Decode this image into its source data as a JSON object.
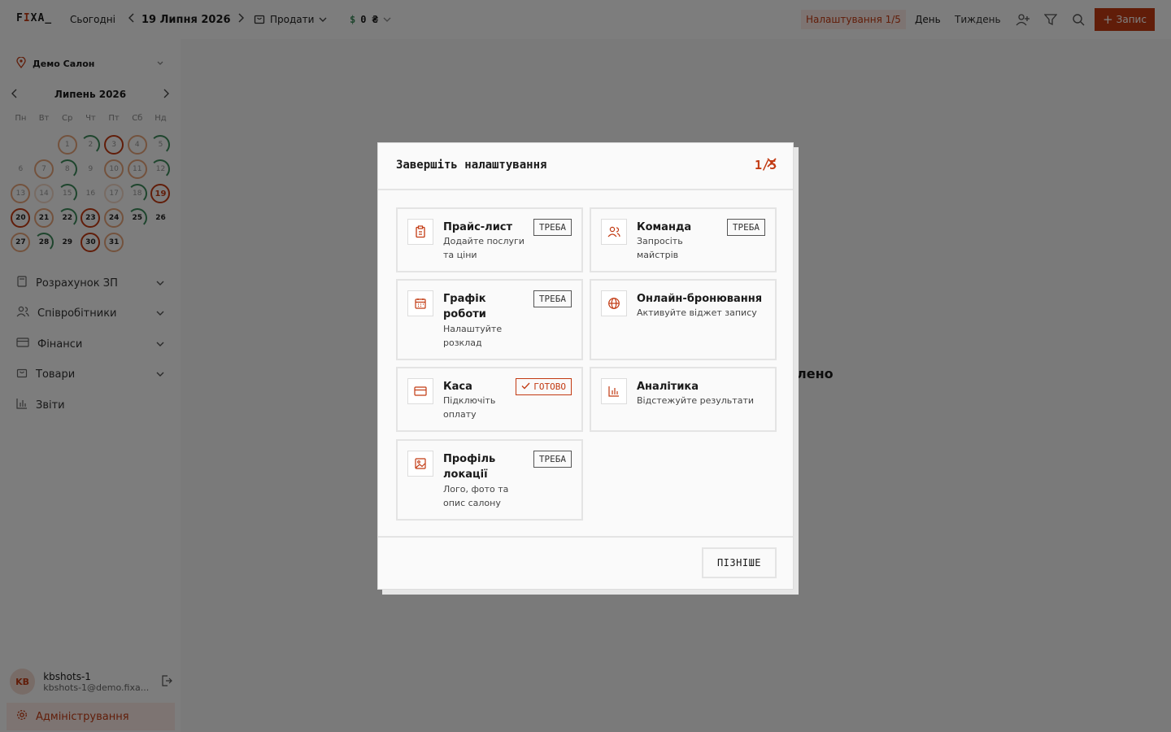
{
  "topbar": {
    "logo_prefix": "F",
    "logo_accent": "I",
    "logo_suffix": "XA_",
    "today": "Сьогодні",
    "date": "19 Липня 2026",
    "sell": "Продати",
    "money": "0 ₴",
    "setup": "Налаштування 1/5",
    "view_day": "День",
    "view_week": "Тиждень",
    "new_booking": "Запис"
  },
  "sidebar": {
    "location": "Демо Салон",
    "calendar": {
      "month": "Липень 2026",
      "weekdays": [
        "Пн",
        "Вт",
        "Ср",
        "Чт",
        "Пт",
        "Сб",
        "Нд"
      ],
      "today": "19"
    },
    "nav": [
      {
        "label": "Розрахунок ЗП"
      },
      {
        "label": "Співробітники"
      },
      {
        "label": "Фінанси"
      },
      {
        "label": "Товари"
      },
      {
        "label": "Звіти"
      }
    ],
    "user": {
      "initials": "KB",
      "name": "kbshots-1",
      "email": "kbshots-1@demo.fixa..."
    },
    "admin": "Адміністрування"
  },
  "background_text": "лено",
  "modal": {
    "title": "Завершіть налаштування",
    "count": "1/5",
    "cards": [
      {
        "title": "Прайс-лист",
        "desc": "Додайте послуги та ціни",
        "badge": "ТРЕБА"
      },
      {
        "title": "Команда",
        "desc": "Запросіть майстрів",
        "badge": "ТРЕБА"
      },
      {
        "title": "Графік роботи",
        "desc": "Налаштуйте розклад",
        "badge": "ТРЕБА"
      },
      {
        "title": "Онлайн-бронювання",
        "desc": "Активуйте віджет запису"
      },
      {
        "title": "Каса",
        "desc": "Підключіть оплату",
        "badge": "ГОТОВО"
      },
      {
        "title": "Аналітика",
        "desc": "Відстежуйте результати"
      },
      {
        "title": "Профіль локації",
        "desc": "Лого, фото та опис салону",
        "badge": "ТРЕБА"
      }
    ],
    "later": "ПІЗНІШЕ"
  },
  "colors": {
    "accent": "#c23a12",
    "accent_light": "#fbe9e4",
    "success": "#3c8a5a"
  }
}
